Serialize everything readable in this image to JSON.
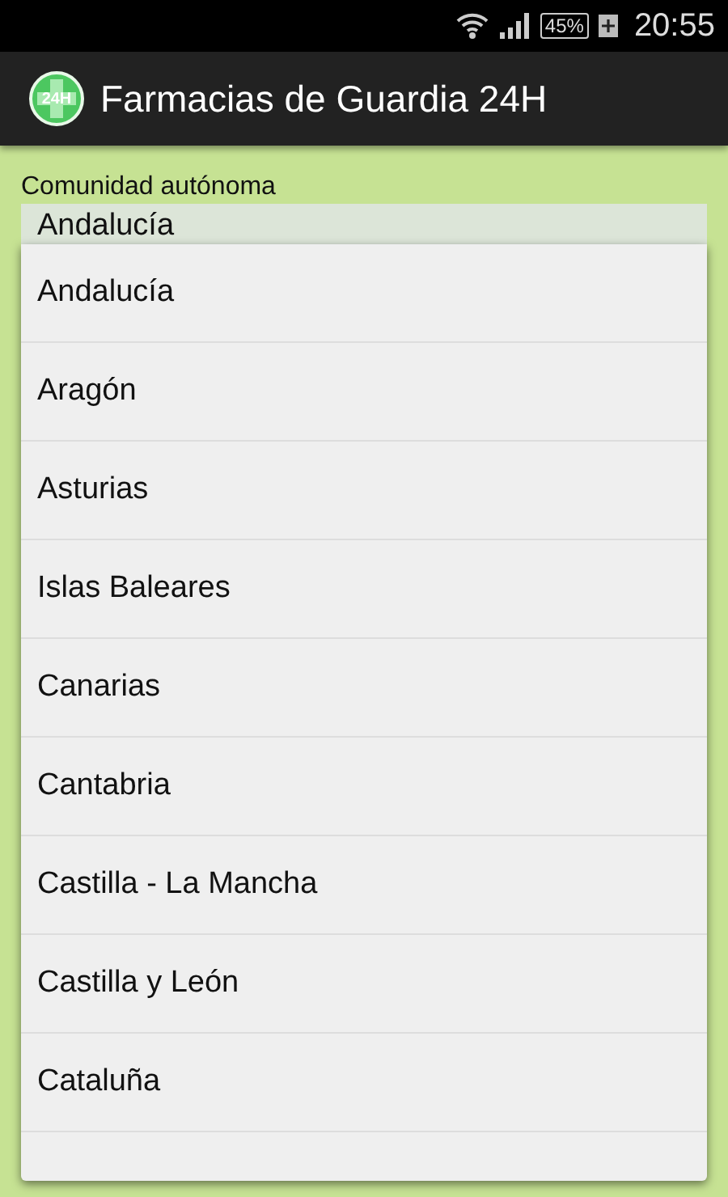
{
  "status_bar": {
    "battery": "45%",
    "time": "20:55"
  },
  "action_bar": {
    "logo": "24H",
    "title": "Farmacias de Guardia 24H"
  },
  "field": {
    "label": "Comunidad autónoma",
    "value": "Andalucía"
  },
  "dropdown": {
    "options": [
      "Andalucía",
      "Aragón",
      "Asturias",
      "Islas Baleares",
      "Canarias",
      "Cantabria",
      "Castilla - La Mancha",
      "Castilla y León",
      "Cataluña"
    ]
  }
}
